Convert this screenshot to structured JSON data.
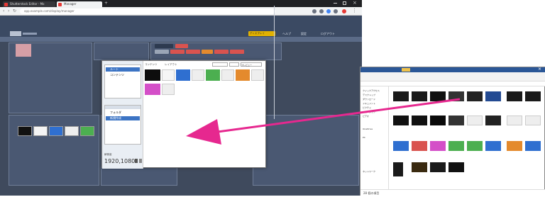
{
  "browser": {
    "tabs": [
      {
        "label": "Shutterstock Editor - Mo"
      },
      {
        "label": "Manager"
      }
    ],
    "new_tab": "+",
    "url": "app.example.com/display/manager"
  },
  "app": {
    "header_right": [
      "ディスプレイ",
      "ヘルプ",
      "設定",
      "ログアウト"
    ]
  },
  "dialog": {
    "tree_items": [
      "ルート",
      "コンテンツ"
    ],
    "group_items": [
      "フォルダ",
      "新規作成"
    ],
    "resolution_label": "解像度",
    "resolution": "1920,1080",
    "tabs": [
      "コンテンツ",
      "レイアウト",
      "プレビュー"
    ]
  },
  "explorer": {
    "status": "28 個の項目",
    "nav_items": [
      "クイックアクセス",
      "デスクトップ",
      "ダウンロード",
      "ドキュメント",
      "ピクチャ",
      "ミュージック",
      "ビデオ",
      "OneDrive",
      "PC",
      "ネットワーク"
    ]
  },
  "colors": {
    "arrow": "#e6288f",
    "app_header": "#3b4a63",
    "selection": "#3c74c4"
  }
}
